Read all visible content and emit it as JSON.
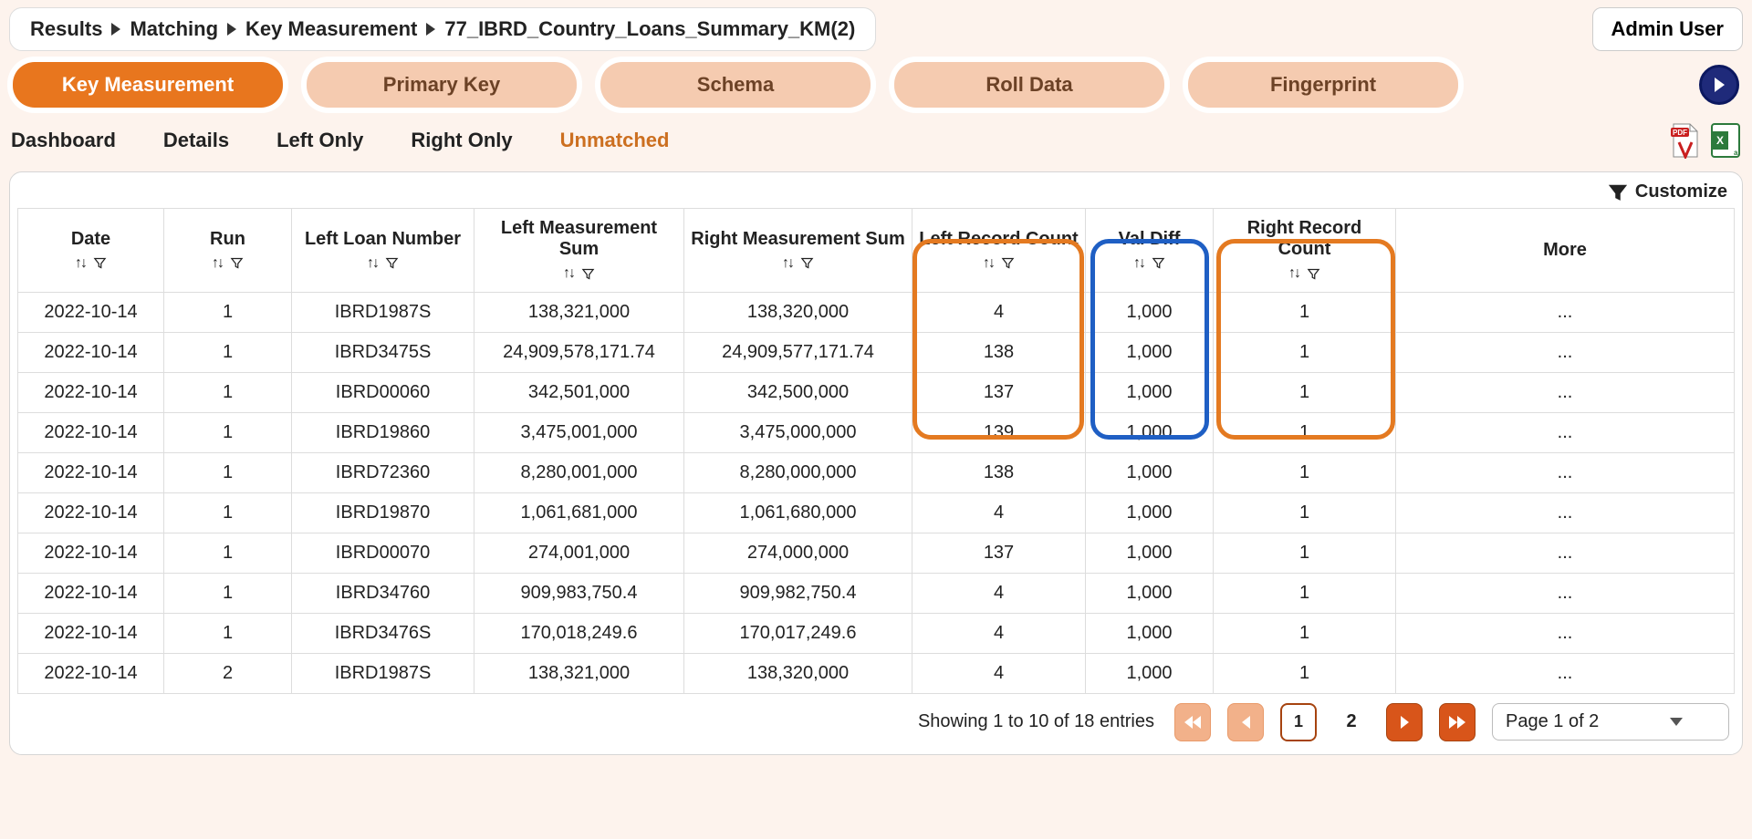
{
  "breadcrumb": [
    "Results",
    "Matching",
    "Key Measurement",
    "77_IBRD_Country_Loans_Summary_KM(2)"
  ],
  "admin_label": "Admin User",
  "main_tabs": [
    "Key Measurement",
    "Primary Key",
    "Schema",
    "Roll Data",
    "Fingerprint"
  ],
  "main_tab_active_index": 0,
  "sub_tabs": [
    "Dashboard",
    "Details",
    "Left Only",
    "Right Only",
    "Unmatched"
  ],
  "sub_tab_active_index": 4,
  "customize_label": "Customize",
  "columns": [
    "Date",
    "Run",
    "Left Loan Number",
    "Left Measurement Sum",
    "Right Measurement Sum",
    "Left Record Count",
    "Val Diff",
    "Right Record Count",
    "More"
  ],
  "rows": [
    {
      "date": "2022-10-14",
      "run": "1",
      "lln": "IBRD1987S",
      "lms": "138,321,000",
      "rms": "138,320,000",
      "lrc": "4",
      "vd": "1,000",
      "rrc": "1",
      "more": "..."
    },
    {
      "date": "2022-10-14",
      "run": "1",
      "lln": "IBRD3475S",
      "lms": "24,909,578,171.74",
      "rms": "24,909,577,171.74",
      "lrc": "138",
      "vd": "1,000",
      "rrc": "1",
      "more": "..."
    },
    {
      "date": "2022-10-14",
      "run": "1",
      "lln": "IBRD00060",
      "lms": "342,501,000",
      "rms": "342,500,000",
      "lrc": "137",
      "vd": "1,000",
      "rrc": "1",
      "more": "..."
    },
    {
      "date": "2022-10-14",
      "run": "1",
      "lln": "IBRD19860",
      "lms": "3,475,001,000",
      "rms": "3,475,000,000",
      "lrc": "139",
      "vd": "1,000",
      "rrc": "1",
      "more": "..."
    },
    {
      "date": "2022-10-14",
      "run": "1",
      "lln": "IBRD72360",
      "lms": "8,280,001,000",
      "rms": "8,280,000,000",
      "lrc": "138",
      "vd": "1,000",
      "rrc": "1",
      "more": "..."
    },
    {
      "date": "2022-10-14",
      "run": "1",
      "lln": "IBRD19870",
      "lms": "1,061,681,000",
      "rms": "1,061,680,000",
      "lrc": "4",
      "vd": "1,000",
      "rrc": "1",
      "more": "..."
    },
    {
      "date": "2022-10-14",
      "run": "1",
      "lln": "IBRD00070",
      "lms": "274,001,000",
      "rms": "274,000,000",
      "lrc": "137",
      "vd": "1,000",
      "rrc": "1",
      "more": "..."
    },
    {
      "date": "2022-10-14",
      "run": "1",
      "lln": "IBRD34760",
      "lms": "909,983,750.4",
      "rms": "909,982,750.4",
      "lrc": "4",
      "vd": "1,000",
      "rrc": "1",
      "more": "..."
    },
    {
      "date": "2022-10-14",
      "run": "1",
      "lln": "IBRD3476S",
      "lms": "170,018,249.6",
      "rms": "170,017,249.6",
      "lrc": "4",
      "vd": "1,000",
      "rrc": "1",
      "more": "..."
    },
    {
      "date": "2022-10-14",
      "run": "2",
      "lln": "IBRD1987S",
      "lms": "138,321,000",
      "rms": "138,320,000",
      "lrc": "4",
      "vd": "1,000",
      "rrc": "1",
      "more": "..."
    }
  ],
  "pager": {
    "showing_text": "Showing 1 to 10 of 18 entries",
    "current_page": "1",
    "other_page": "2",
    "page_select_label": "Page 1 of 2"
  }
}
